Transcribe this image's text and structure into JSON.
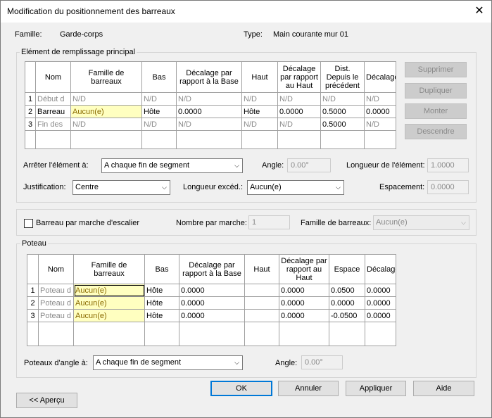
{
  "window": {
    "title": "Modification du positionnement des barreaux",
    "close": "✕"
  },
  "header": {
    "family_label": "Famille:",
    "family_value": "Garde-corps",
    "type_label": "Type:",
    "type_value": "Main courante mur 01"
  },
  "main_group": {
    "title": "Elément de remplissage principal",
    "columns": [
      "Nom",
      "Famille de barreaux",
      "Bas",
      "Décalage par rapport à la Base",
      "Haut",
      "Décalage par rapport au Haut",
      "Dist. Depuis le précédent",
      "Décalage"
    ],
    "rows": [
      [
        "1",
        "Début d",
        "N/D",
        "N/D",
        "N/D",
        "N/D",
        "N/D",
        "N/D",
        "N/D"
      ],
      [
        "2",
        "Barreau",
        "Aucun(e)",
        "Hôte",
        "0.0000",
        "Hôte",
        "0.0000",
        "0.5000",
        "0.0000"
      ],
      [
        "3",
        "Fin des",
        "N/D",
        "N/D",
        "N/D",
        "N/D",
        "N/D",
        "0.5000",
        "N/D"
      ]
    ],
    "buttons": {
      "delete": "Supprimer",
      "duplicate": "Dupliquer",
      "up": "Monter",
      "down": "Descendre"
    },
    "stop_label": "Arrêter l'élément à:",
    "stop_value": "A chaque fin de segment",
    "angle_label": "Angle:",
    "angle_value": "0.00°",
    "length_label": "Longueur de l'élément:",
    "length_value": "1.0000",
    "justification_label": "Justification:",
    "justification_value": "Centre",
    "excess_label": "Longueur excéd.:",
    "excess_value": "Aucun(e)",
    "spacing_label": "Espacement:",
    "spacing_value": "0.0000"
  },
  "stair": {
    "checkbox_label": "Barreau par marche d'escalier",
    "per_step_label": "Nombre par marche:",
    "per_step_value": "1",
    "family_label": "Famille de barreaux:",
    "family_value": "Aucun(e)"
  },
  "posts": {
    "title": "Poteau",
    "columns": [
      "Nom",
      "Famille de barreaux",
      "Bas",
      "Décalage par rapport à la Base",
      "Haut",
      "Décalage par rapport au Haut",
      "Espace",
      "Décalage"
    ],
    "rows": [
      [
        "1",
        "Poteau d",
        "Aucun(e)",
        "Hôte",
        "0.0000",
        "",
        "0.0000",
        "0.0500",
        "0.0000"
      ],
      [
        "2",
        "Poteau d",
        "Aucun(e)",
        "Hôte",
        "0.0000",
        "",
        "0.0000",
        "0.0000",
        "0.0000"
      ],
      [
        "3",
        "Poteau d",
        "Aucun(e)",
        "Hôte",
        "0.0000",
        "",
        "0.0000",
        "-0.0500",
        "0.0000"
      ]
    ],
    "corner_label": "Poteaux d'angle à:",
    "corner_value": "A chaque fin de segment",
    "angle_label": "Angle:",
    "angle_value": "0.00°"
  },
  "footer": {
    "ok": "OK",
    "cancel": "Annuler",
    "apply": "Appliquer",
    "help": "Aide",
    "preview": "<< Aperçu"
  }
}
